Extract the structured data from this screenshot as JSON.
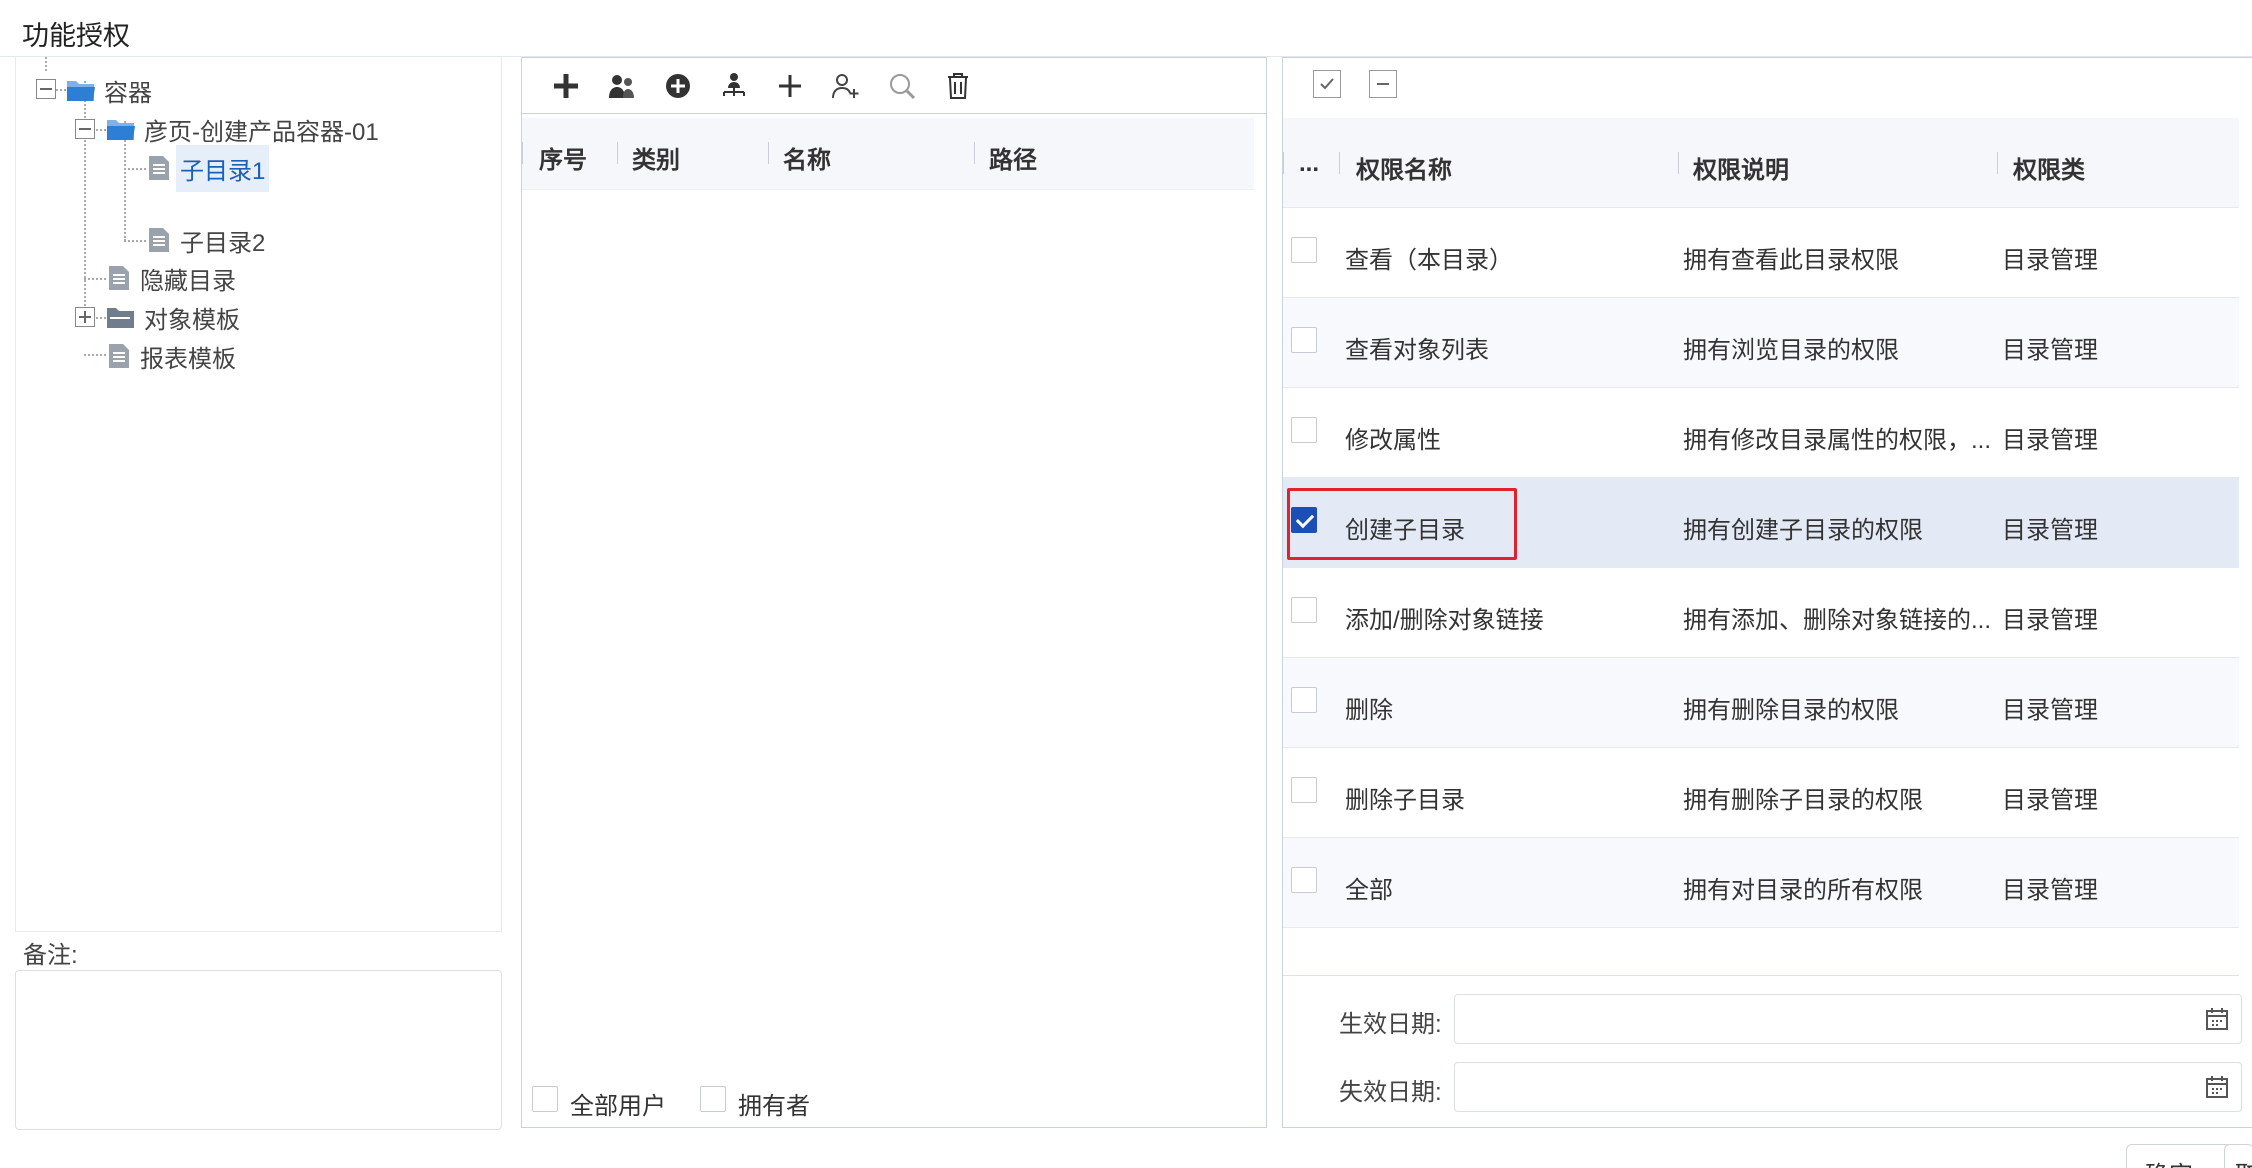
{
  "window": {
    "title": "功能授权"
  },
  "tree": {
    "root": "容器",
    "container": "彦页-创建产品容器-01",
    "sub1": "子目录1",
    "sub2": "子目录2",
    "hidden": "隐藏目录",
    "object_template": "对象模板",
    "report_template": "报表模板"
  },
  "remark": {
    "label": "备注:"
  },
  "middle": {
    "toolbar": [
      "add-icon",
      "users-icon",
      "add-circle-icon",
      "org-icon",
      "plus-icon",
      "add-user-icon",
      "search-icon",
      "delete-icon"
    ],
    "columns": {
      "seq": "序号",
      "category": "类别",
      "name": "名称",
      "path": "路径"
    },
    "footer": {
      "all_users": "全部用户",
      "owner": "拥有者"
    }
  },
  "right": {
    "toolbar": [
      "check-all-icon",
      "uncheck-all-icon"
    ],
    "columns": {
      "more": "...",
      "name": "权限名称",
      "desc": "权限说明",
      "type": "权限类"
    },
    "rows": [
      {
        "name": "查看（本目录）",
        "desc": "拥有查看此目录权限",
        "type": "目录管理",
        "checked": false
      },
      {
        "name": "查看对象列表",
        "desc": "拥有浏览目录的权限",
        "type": "目录管理",
        "checked": false
      },
      {
        "name": "修改属性",
        "desc": "拥有修改目录属性的权限，...",
        "type": "目录管理",
        "checked": false
      },
      {
        "name": "创建子目录",
        "desc": "拥有创建子目录的权限",
        "type": "目录管理",
        "checked": true
      },
      {
        "name": "添加/删除对象链接",
        "desc": "拥有添加、删除对象链接的...",
        "type": "目录管理",
        "checked": false
      },
      {
        "name": "删除",
        "desc": "拥有删除目录的权限",
        "type": "目录管理",
        "checked": false
      },
      {
        "name": "删除子目录",
        "desc": "拥有删除子目录的权限",
        "type": "目录管理",
        "checked": false
      },
      {
        "name": "全部",
        "desc": "拥有对目录的所有权限",
        "type": "目录管理",
        "checked": false
      }
    ],
    "effective_date_label": "生效日期:",
    "expire_date_label": "失效日期:",
    "effective_date_value": "",
    "expire_date_value": ""
  },
  "buttons": {
    "confirm": "确定",
    "cancel": "取消"
  },
  "colors": {
    "accent": "#1b4fb6",
    "highlight": "#e0222e",
    "selected_row": "#e3e9f5",
    "folder": "#2d7fd6"
  }
}
